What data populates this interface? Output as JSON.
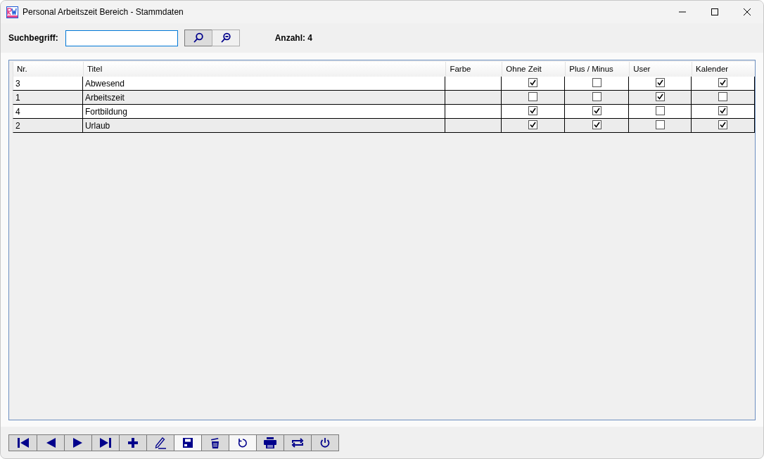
{
  "window": {
    "title": "Personal Arbeitszeit Bereich - Stammdaten"
  },
  "search": {
    "label": "Suchbegriff:",
    "buttons": [
      {
        "kind": "search",
        "pressed": true
      },
      {
        "kind": "clear-search",
        "pressed": false
      }
    ],
    "count": "Anzahl: 4"
  },
  "table": {
    "columns": [
      {
        "label": "Nr.",
        "kind": "text"
      },
      {
        "label": "Titel",
        "kind": "text"
      },
      {
        "label": "Farbe",
        "kind": "color"
      },
      {
        "label": "Ohne Zeit",
        "kind": "check"
      },
      {
        "label": "Plus / Minus",
        "kind": "check"
      },
      {
        "label": "User",
        "kind": "check"
      },
      {
        "label": "Kalender",
        "kind": "check"
      }
    ],
    "rows": [
      {
        "nr": "3",
        "titel": "Abwesend",
        "ohne_zeit": true,
        "plus_minus": false,
        "user": true,
        "kalender": true
      },
      {
        "nr": "1",
        "titel": "Arbeitszeit",
        "ohne_zeit": false,
        "plus_minus": false,
        "user": true,
        "kalender": false
      },
      {
        "nr": "4",
        "titel": "Fortbildung",
        "ohne_zeit": true,
        "plus_minus": true,
        "user": false,
        "kalender": true
      },
      {
        "nr": "2",
        "titel": "Urlaub",
        "ohne_zeit": true,
        "plus_minus": true,
        "user": false,
        "kalender": true
      }
    ]
  },
  "toolbar": [
    {
      "kind": "first",
      "highlighted": false
    },
    {
      "kind": "previous",
      "highlighted": false
    },
    {
      "kind": "next",
      "highlighted": false
    },
    {
      "kind": "last",
      "highlighted": false
    },
    {
      "kind": "add",
      "highlighted": false
    },
    {
      "kind": "edit",
      "highlighted": false
    },
    {
      "kind": "save",
      "highlighted": true
    },
    {
      "kind": "delete",
      "highlighted": false
    },
    {
      "kind": "undo",
      "highlighted": true
    },
    {
      "kind": "print",
      "highlighted": false
    },
    {
      "kind": "swap",
      "highlighted": false
    },
    {
      "kind": "power",
      "highlighted": false
    }
  ]
}
